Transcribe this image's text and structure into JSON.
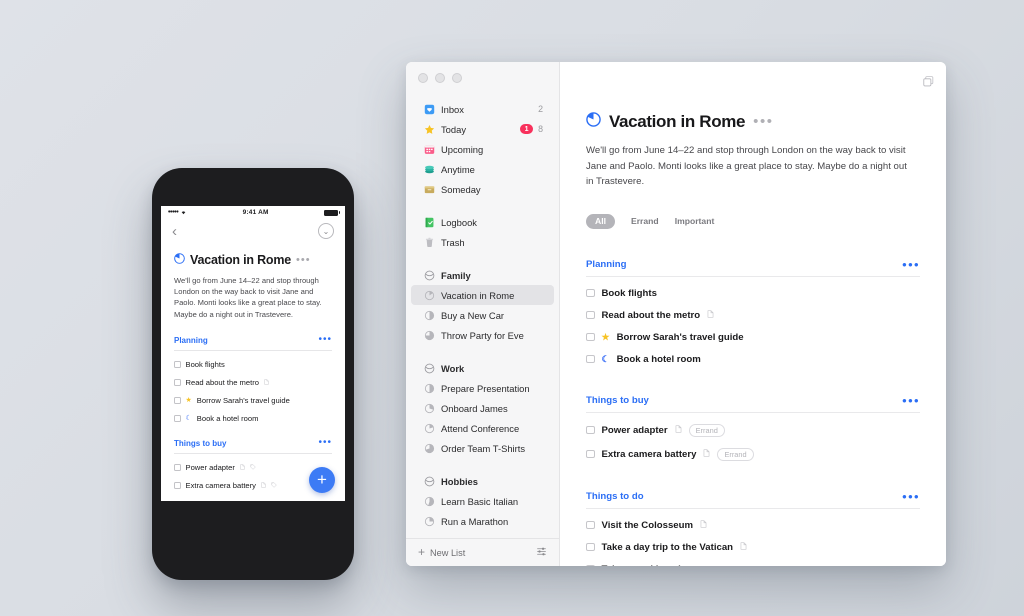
{
  "phone": {
    "status": {
      "signal": "•••••",
      "wifi": "wifi-icon",
      "time": "9:41 AM"
    },
    "nav": {
      "back": "‹",
      "collapse": "⌄"
    },
    "title": "Vacation in Rome",
    "title_menu": "•••",
    "note": "We'll go from June 14–22 and stop through London on the way back to visit Jane and Paolo. Monti looks like a great place to stay. Maybe do a night out in Trastevere.",
    "sections": [
      {
        "title": "Planning",
        "menu": "•••",
        "tasks": [
          {
            "label": "Book flights",
            "star": false,
            "moon": false,
            "note_icon": false,
            "tag_icon": false
          },
          {
            "label": "Read about the metro",
            "star": false,
            "moon": false,
            "note_icon": true,
            "tag_icon": false
          },
          {
            "label": "Borrow Sarah's travel guide",
            "star": true,
            "moon": false,
            "note_icon": false,
            "tag_icon": false
          },
          {
            "label": "Book a hotel room",
            "star": false,
            "moon": true,
            "note_icon": false,
            "tag_icon": false
          }
        ]
      },
      {
        "title": "Things to buy",
        "menu": "•••",
        "tasks": [
          {
            "label": "Power adapter",
            "star": false,
            "moon": false,
            "note_icon": true,
            "tag_icon": true
          },
          {
            "label": "Extra camera battery",
            "star": false,
            "moon": false,
            "note_icon": true,
            "tag_icon": true
          }
        ]
      }
    ],
    "fab": "+"
  },
  "window": {
    "traffic_lights": [
      "close-button",
      "minimize-button",
      "zoom-button"
    ],
    "corner_icon": "multiple-windows-icon"
  },
  "sidebar": {
    "items": [
      {
        "label": "Inbox",
        "icon": "inbox-icon",
        "count": "2",
        "badge": "",
        "type": "item"
      },
      {
        "label": "Today",
        "icon": "star-icon",
        "count": "8",
        "badge": "1",
        "type": "item"
      },
      {
        "label": "Upcoming",
        "icon": "calendar-icon",
        "count": "",
        "badge": "",
        "type": "item"
      },
      {
        "label": "Anytime",
        "icon": "layers-icon",
        "count": "",
        "badge": "",
        "type": "item"
      },
      {
        "label": "Someday",
        "icon": "box-icon",
        "count": "",
        "badge": "",
        "type": "item"
      },
      {
        "label": "",
        "icon": "",
        "count": "",
        "badge": "",
        "type": "gap"
      },
      {
        "label": "Logbook",
        "icon": "logbook-icon",
        "count": "",
        "badge": "",
        "type": "item"
      },
      {
        "label": "Trash",
        "icon": "trash-icon",
        "count": "",
        "badge": "",
        "type": "item"
      },
      {
        "label": "",
        "icon": "",
        "count": "",
        "badge": "",
        "type": "gap"
      },
      {
        "label": "Family",
        "icon": "area-icon",
        "count": "",
        "badge": "",
        "type": "group"
      },
      {
        "label": "Vacation in Rome",
        "icon": "progress-icon",
        "progress": 15,
        "count": "",
        "badge": "",
        "type": "project",
        "selected": true
      },
      {
        "label": "Buy a New Car",
        "icon": "progress-icon",
        "progress": 50,
        "count": "",
        "badge": "",
        "type": "project"
      },
      {
        "label": "Throw Party for Eve",
        "icon": "progress-icon",
        "progress": 75,
        "count": "",
        "badge": "",
        "type": "project"
      },
      {
        "label": "",
        "icon": "",
        "count": "",
        "badge": "",
        "type": "gap"
      },
      {
        "label": "Work",
        "icon": "area-icon",
        "count": "",
        "badge": "",
        "type": "group"
      },
      {
        "label": "Prepare Presentation",
        "icon": "progress-icon",
        "progress": 50,
        "count": "",
        "badge": "",
        "type": "project"
      },
      {
        "label": "Onboard James",
        "icon": "progress-icon",
        "progress": 30,
        "count": "",
        "badge": "",
        "type": "project"
      },
      {
        "label": "Attend Conference",
        "icon": "progress-icon",
        "progress": 20,
        "count": "",
        "badge": "",
        "type": "project"
      },
      {
        "label": "Order Team T-Shirts",
        "icon": "progress-icon",
        "progress": 70,
        "count": "",
        "badge": "",
        "type": "project"
      },
      {
        "label": "",
        "icon": "",
        "count": "",
        "badge": "",
        "type": "gap"
      },
      {
        "label": "Hobbies",
        "icon": "area-icon",
        "count": "",
        "badge": "",
        "type": "group"
      },
      {
        "label": "Learn Basic Italian",
        "icon": "progress-icon",
        "progress": 55,
        "count": "",
        "badge": "",
        "type": "project"
      },
      {
        "label": "Run a Marathon",
        "icon": "progress-icon",
        "progress": 25,
        "count": "",
        "badge": "",
        "type": "project"
      }
    ],
    "footer": {
      "new_list": "New List",
      "plus": "+",
      "settings_icon": "sliders-icon"
    }
  },
  "main": {
    "title": "Vacation in Rome",
    "title_icon": "progress-icon",
    "title_menu": "•••",
    "note": "We'll go from June 14–22 and stop through London on the way back to visit Jane and Paolo. Monti looks like a great place to stay. Maybe do a night out in Trastevere.",
    "filters": [
      {
        "label": "All",
        "active": true
      },
      {
        "label": "Errand",
        "active": false
      },
      {
        "label": "Important",
        "active": false
      }
    ],
    "sections": [
      {
        "title": "Planning",
        "menu": "•••",
        "tasks": [
          {
            "label": "Book flights",
            "star": false,
            "moon": false,
            "note_icon": false,
            "tag": ""
          },
          {
            "label": "Read about the metro",
            "star": false,
            "moon": false,
            "note_icon": true,
            "tag": ""
          },
          {
            "label": "Borrow Sarah's travel guide",
            "star": true,
            "moon": false,
            "note_icon": false,
            "tag": ""
          },
          {
            "label": "Book a hotel room",
            "star": false,
            "moon": true,
            "note_icon": false,
            "tag": ""
          }
        ]
      },
      {
        "title": "Things to buy",
        "menu": "•••",
        "tasks": [
          {
            "label": "Power adapter",
            "star": false,
            "moon": false,
            "note_icon": true,
            "tag": "Errand"
          },
          {
            "label": "Extra camera battery",
            "star": false,
            "moon": false,
            "note_icon": true,
            "tag": "Errand"
          }
        ]
      },
      {
        "title": "Things to do",
        "menu": "•••",
        "tasks": [
          {
            "label": "Visit the Colosseum",
            "star": false,
            "moon": false,
            "note_icon": true,
            "tag": ""
          },
          {
            "label": "Take a day trip to the Vatican",
            "star": false,
            "moon": false,
            "note_icon": true,
            "tag": ""
          },
          {
            "label": "Take a cooking class",
            "star": false,
            "moon": false,
            "note_icon": false,
            "tag": ""
          }
        ]
      }
    ]
  }
}
